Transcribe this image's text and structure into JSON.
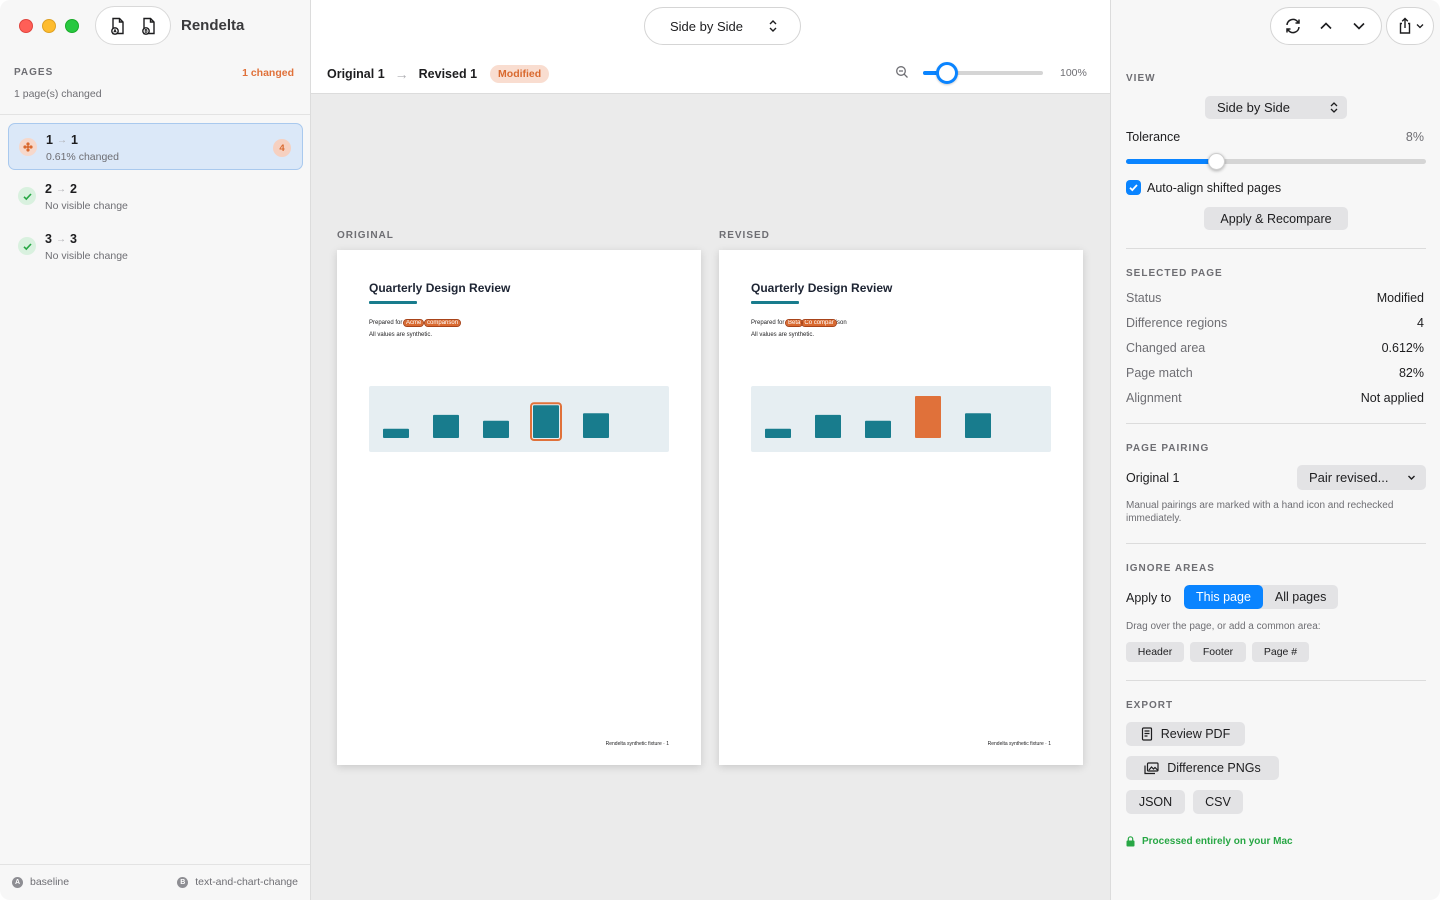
{
  "app": {
    "title": "Rendelta"
  },
  "sidebar": {
    "header": "PAGES",
    "changed_count": "1 changed",
    "subtitle": "1 page(s) changed",
    "items": [
      {
        "from": "1",
        "to": "1",
        "status": "0.61% changed",
        "badge": "4",
        "state": "modified",
        "arrow": "→"
      },
      {
        "from": "2",
        "to": "2",
        "status": "No visible change",
        "state": "unchanged",
        "arrow": "→"
      },
      {
        "from": "3",
        "to": "3",
        "status": "No visible change",
        "state": "unchanged",
        "arrow": "→"
      }
    ],
    "footer": {
      "left_dot": "A",
      "left": "baseline",
      "right_dot": "B",
      "right": "text-and-chart-change"
    }
  },
  "toolbar": {
    "mode": "Side by Side",
    "crumb_original": "Original 1",
    "crumb_arrow": "→",
    "crumb_revised": "Revised 1",
    "crumb_badge": "Modified",
    "zoom": 100,
    "zoom_label": "100%"
  },
  "viewer": {
    "original_label": "ORIGINAL",
    "revised_label": "REVISED",
    "original": {
      "title": "Quarterly Design Review",
      "prepared_prefix": "Prepared for ",
      "prepared_hl1": "Acme",
      "prepared_hl2": "comparison",
      "note": "All values are synthetic.",
      "footer": "Rendelta synthetic fixture · 1",
      "bars": [
        0.22,
        0.55,
        0.41,
        0.78,
        0.59
      ],
      "highlight_index": 3
    },
    "revised": {
      "title": "Quarterly Design Review",
      "prepared_prefix": "Prepared for ",
      "prepared_hl1": "Beta",
      "prepared_hl2": "Co compar",
      "prepared_suffix": "ison",
      "note": "All values are synthetic.",
      "footer": "Rendelta synthetic fixture · 1",
      "bars": [
        0.22,
        0.55,
        0.41,
        1.0,
        0.59
      ],
      "highlight_index": 3
    }
  },
  "colors": {
    "bar": "#187c8d",
    "changed_bar": "#e0713a",
    "accent": "#0a84ff",
    "modified": "#d9692f"
  },
  "panel": {
    "view_head": "VIEW",
    "view_mode": "Side by Side",
    "tolerance_label": "Tolerance",
    "tolerance_value": "8%",
    "tolerance_fraction": 0.3,
    "auto_align_label": "Auto-align shifted pages",
    "auto_align_checked": true,
    "apply_btn": "Apply & Recompare",
    "selected_head": "SELECTED PAGE",
    "rows": [
      {
        "label": "Status",
        "value": "Modified"
      },
      {
        "label": "Difference regions",
        "value": "4"
      },
      {
        "label": "Changed area",
        "value": "0.612%"
      },
      {
        "label": "Page match",
        "value": "82%"
      },
      {
        "label": "Alignment",
        "value": "Not applied"
      }
    ],
    "pairing_head": "PAGE PAIRING",
    "pairing_label": "Original 1",
    "pairing_select": "Pair revised...",
    "pairing_note": "Manual pairings are marked with a hand icon and rechecked immediately.",
    "ignore_head": "IGNORE AREAS",
    "apply_to": "Apply to",
    "seg_this": "This page",
    "seg_all": "All pages",
    "ignore_note": "Drag over the page, or add a common area:",
    "chips": [
      "Header",
      "Footer",
      "Page #"
    ],
    "export_head": "EXPORT",
    "export_review": "Review PDF",
    "export_pngs": "Difference PNGs",
    "export_json": "JSON",
    "export_csv": "CSV",
    "secure_note": "Processed entirely on your Mac"
  },
  "icons": {
    "doc_open_original": "document-a-icon",
    "doc_open_revised": "document-b-icon",
    "refresh": "refresh-icon",
    "prev": "chevron-up-icon",
    "next": "chevron-down-icon",
    "share": "share-icon",
    "zoom": "magnifier-icon",
    "lock": "lock-icon"
  }
}
